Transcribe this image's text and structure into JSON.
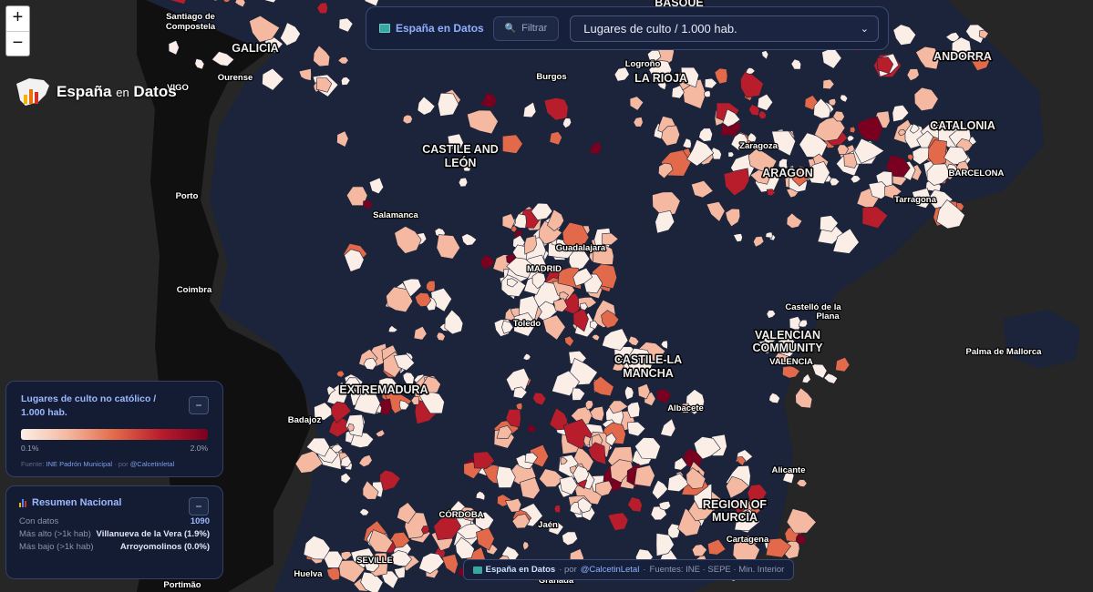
{
  "topbar": {
    "brand": "España en Datos",
    "filter_label": "Filtrar",
    "indicator_selected": "Lugares de culto / 1.000 hab."
  },
  "logo": {
    "main": "España",
    "en": "en",
    "datos": "Datos"
  },
  "zoom": {
    "in": "+",
    "out": "−"
  },
  "legend": {
    "title": "Lugares de culto no católico / 1.000 hab.",
    "min": "0.1%",
    "max": "2.0%",
    "source_prefix": "Fuente:",
    "source": "INE Padrón Municipal",
    "by": "· por",
    "author": "@Calcetinletal",
    "collapse": "−",
    "colors": [
      "#fbeee6",
      "#f5b8a0",
      "#e26a4a",
      "#b81d2c",
      "#7a0020"
    ]
  },
  "summary": {
    "title": "Resumen Nacional",
    "collapse": "−",
    "rows": [
      {
        "label": "Con datos",
        "value": "1090"
      },
      {
        "label": "Más alto (>1k hab)",
        "value": "Villanueva de la Vera (1.9%)"
      },
      {
        "label": "Más bajo (>1k hab)",
        "value": "Arroyomolinos (0.0%)"
      }
    ]
  },
  "footer": {
    "brand": "España en Datos",
    "by": "· por",
    "author": "@CalcetinLetal",
    "sep": "·",
    "sources": "Fuentes: INE · SEPE · Min. Interior"
  },
  "map": {
    "regions": [
      "GALICIA",
      "CASTILE AND",
      "LEÓN",
      "LA RIOJA",
      "ANDORRA",
      "CATALONIA",
      "ARAGON",
      "EXTREMADURA",
      "CASTILE-LA",
      "MANCHA",
      "VALENCIAN",
      "COMMUNITY",
      "REGION OF",
      "MURCIA",
      "BASQUE"
    ],
    "cities": [
      "Santiago de",
      "Compostela",
      "Ourense",
      "VIGO",
      "Porto",
      "Coimbra",
      "Salamanca",
      "Burgos",
      "Logroño",
      "Zaragoza",
      "BARCELONA",
      "Tarragona",
      "Guadalajara",
      "MADRID",
      "Toledo",
      "Castelló de la",
      "Plana",
      "VALENCIA",
      "Palma de Mallorca",
      "Badajoz",
      "Albacete",
      "Alicante",
      "CÓRDOBA",
      "Jaén",
      "Cartagena",
      "SEVILLE",
      "Huelva",
      "Granada",
      "Portimão"
    ]
  }
}
